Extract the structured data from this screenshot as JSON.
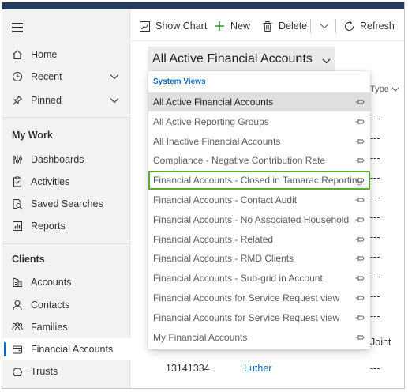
{
  "sidebar": {
    "home": "Home",
    "recent": "Recent",
    "pinned": "Pinned",
    "my_work_title": "My Work",
    "dashboards": "Dashboards",
    "activities": "Activities",
    "saved_searches": "Saved Searches",
    "reports": "Reports",
    "clients_title": "Clients",
    "accounts": "Accounts",
    "contacts": "Contacts",
    "families": "Families",
    "financial_accounts": "Financial Accounts",
    "trusts": "Trusts"
  },
  "toolbar": {
    "show_chart": "Show Chart",
    "new": "New",
    "delete": "Delete",
    "refresh": "Refresh"
  },
  "view_selector": {
    "label": "All Active Financial Accounts"
  },
  "grid": {
    "type_header": "Type",
    "cells": [
      "---",
      "---",
      "---",
      "---",
      "---",
      "---",
      "---",
      "---",
      "---",
      "---",
      "---",
      "Joint",
      "---"
    ],
    "last_row_id": "13141334",
    "last_row_name": "Luther"
  },
  "dropdown": {
    "section_title": "System Views",
    "items": [
      "All Active Financial Accounts",
      "All Active Reporting Groups",
      "All Inactive Financial Accounts",
      "Compliance - Negative Contribution Rate",
      "Financial Accounts - Closed in Tamarac Reporting",
      "Financial Accounts - Contact Audit",
      "Financial Accounts - No Associated Household",
      "Financial Accounts - Related",
      "Financial Accounts - RMD Clients",
      "Financial Accounts - Sub-grid in Account",
      "Financial Accounts for Service Request view",
      "Financial Accounts for Service Request view",
      "My Financial Accounts"
    ]
  },
  "colors": {
    "topbar": "#243a5e",
    "accent": "#0f6cbd",
    "highlight_outline": "#5cab31",
    "new_icon": "#107c10"
  }
}
